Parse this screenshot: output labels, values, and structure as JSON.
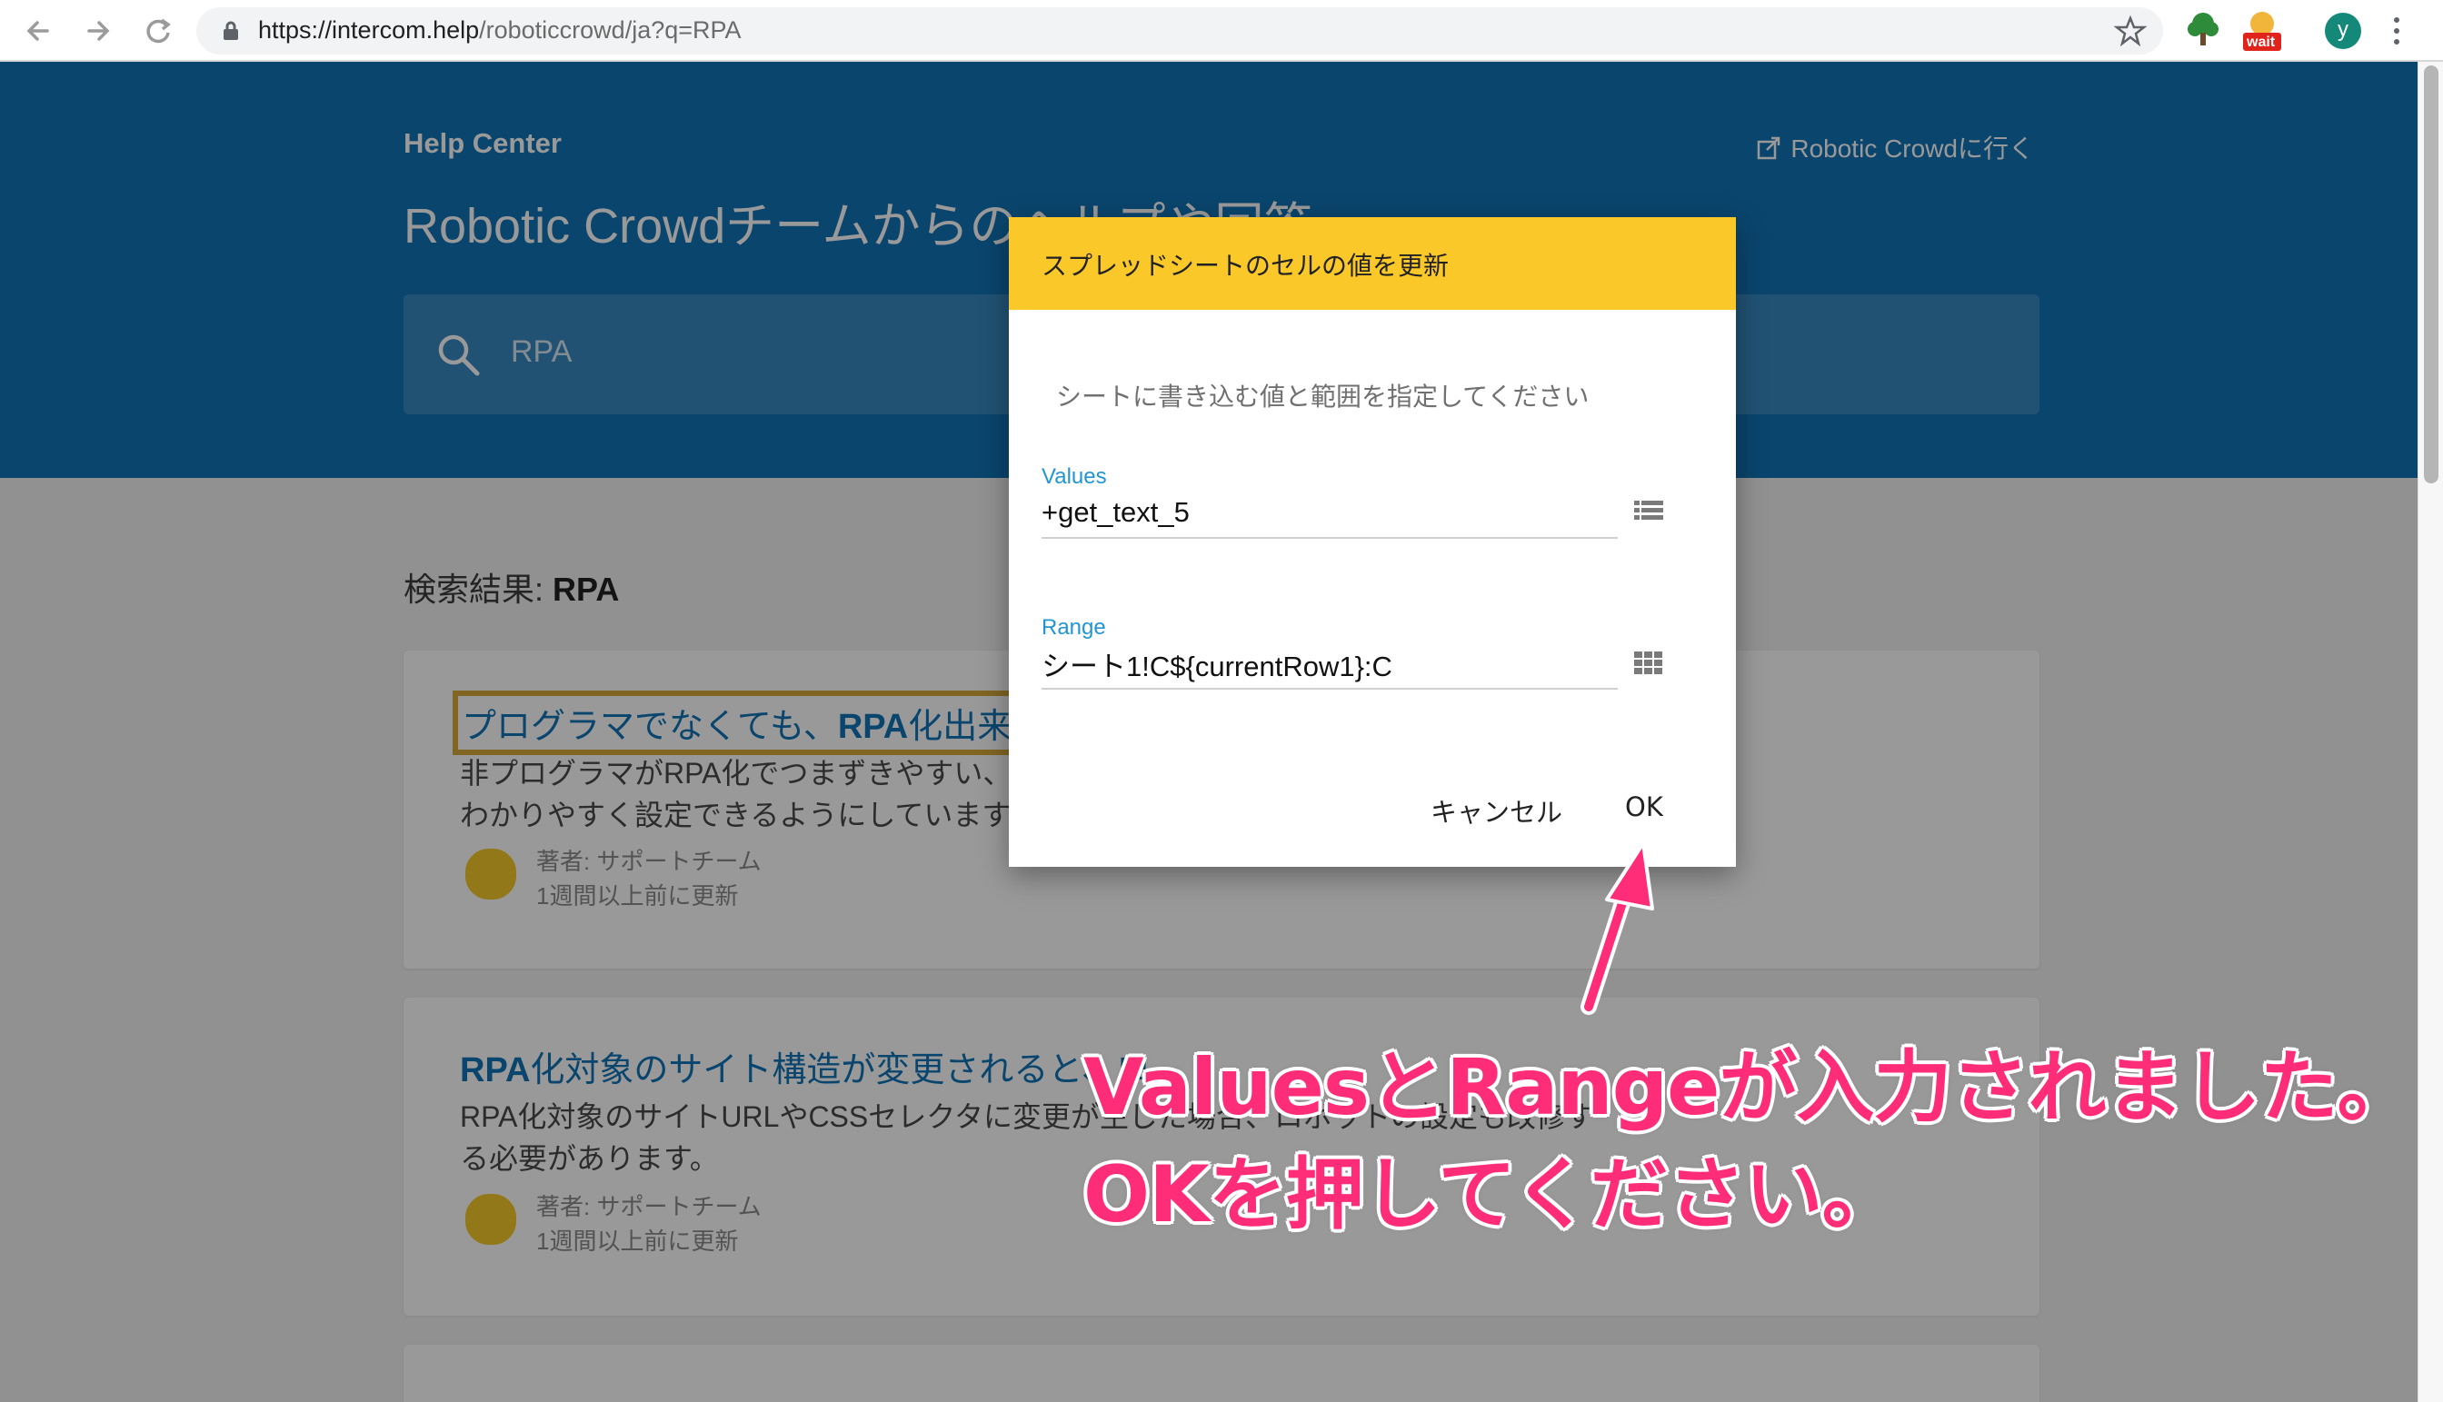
{
  "browser": {
    "url_host": "https://intercom.help",
    "url_path": "/roboticcrowd/ja?q=RPA",
    "ext_badge": "wait",
    "profile_initial": "y"
  },
  "help_center": {
    "label": "Help Center",
    "go_link": "Robotic Crowdに行く",
    "tagline": "Robotic Crowdチームからのヘルプや回答",
    "search_value": "RPA"
  },
  "results": {
    "heading_prefix": "検索結果: ",
    "heading_query": "RPA",
    "cards": [
      {
        "title_pre": "プログラマでなくても、",
        "title_bold": "RPA",
        "title_post": "化出来ま",
        "desc_line1": "非プログラマがRPA化でつまずきやすい、",
        "desc_line2": "わかりやすく設定できるようにしています",
        "author": "著者: サポートチーム",
        "updated": "1週間以上前に更新"
      },
      {
        "title_bold": "RPA",
        "title_post": "化対象のサイト構造が変更されると、ロ",
        "desc_line1": "RPA化対象のサイトURLやCSSセレクタに変更が生じた場合、ロボットの設定も改修す",
        "desc_line2": "る必要があります。",
        "author": "著者: サポートチーム",
        "updated": "1週間以上前に更新"
      }
    ]
  },
  "modal": {
    "title": "スプレッドシートのセルの値を更新",
    "instruction": "シートに書き込む値と範囲を指定してください",
    "values_label": "Values",
    "values_value": "+get_text_5",
    "range_label": "Range",
    "range_value": "シート1!C${currentRow1}:C",
    "cancel_label": "キャンセル",
    "ok_label": "OK"
  },
  "annotation": {
    "line1": "ValuesとRangeが入力されました。",
    "line2": "OKを押してください。"
  },
  "colors": {
    "hero_blue": "#1173b6",
    "modal_header_yellow": "#fbc82a",
    "field_label_blue": "#2196d3",
    "annotation_pink": "#ff2d78"
  }
}
